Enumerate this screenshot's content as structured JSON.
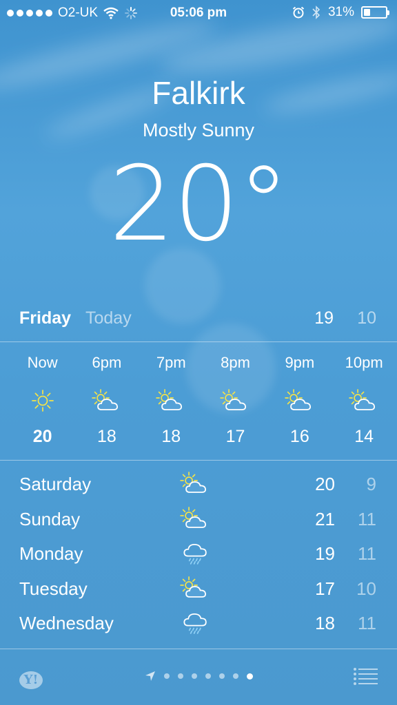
{
  "status": {
    "carrier": "O2-UK",
    "time": "05:06 pm",
    "battery": "31%",
    "battery_level": 0.31
  },
  "header": {
    "city": "Falkirk",
    "condition": "Mostly Sunny",
    "temperature": "20°"
  },
  "today": {
    "day": "Friday",
    "label": "Today",
    "high": "19",
    "low": "10"
  },
  "hourly": [
    {
      "time": "Now",
      "icon": "sun-icon",
      "temp": "20"
    },
    {
      "time": "6pm",
      "icon": "partly-cloudy-icon",
      "temp": "18"
    },
    {
      "time": "7pm",
      "icon": "partly-cloudy-icon",
      "temp": "18"
    },
    {
      "time": "8pm",
      "icon": "partly-cloudy-icon",
      "temp": "17"
    },
    {
      "time": "9pm",
      "icon": "partly-cloudy-icon",
      "temp": "16"
    },
    {
      "time": "10pm",
      "icon": "partly-cloudy-icon",
      "temp": "14"
    }
  ],
  "forecast": [
    {
      "day": "Saturday",
      "icon": "partly-cloudy-icon",
      "high": "20",
      "low": "9"
    },
    {
      "day": "Sunday",
      "icon": "partly-cloudy-icon",
      "high": "21",
      "low": "11"
    },
    {
      "day": "Monday",
      "icon": "rain-cloud-icon",
      "high": "19",
      "low": "11"
    },
    {
      "day": "Tuesday",
      "icon": "partly-cloudy-icon",
      "high": "17",
      "low": "10"
    },
    {
      "day": "Wednesday",
      "icon": "rain-cloud-icon",
      "high": "18",
      "low": "11"
    }
  ],
  "footer": {
    "logo": "Y!",
    "page_count": 8,
    "active_page": 8
  },
  "colors": {
    "sun": "#f2e24a",
    "background": "#4c9dd5"
  }
}
